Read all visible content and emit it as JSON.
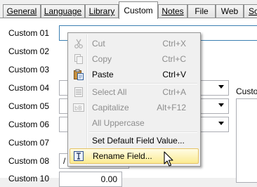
{
  "tabs": [
    {
      "label": "General",
      "active": false
    },
    {
      "label": "Language",
      "active": false
    },
    {
      "label": "Library",
      "active": false
    },
    {
      "label": "Custom",
      "active": true
    },
    {
      "label": "Notes",
      "active": false
    },
    {
      "label": "File",
      "active": false
    },
    {
      "label": "Web",
      "active": false
    },
    {
      "label": "Sc",
      "active": false
    }
  ],
  "fields": [
    {
      "label": "Custom 01"
    },
    {
      "label": "Custom 02"
    },
    {
      "label": "Custom 03"
    },
    {
      "label": "Custom 04"
    },
    {
      "label": "Custom 05"
    },
    {
      "label": "Custom 06"
    },
    {
      "label": "Custom 07"
    },
    {
      "label": "Custom 08",
      "value": "/"
    },
    {
      "label": "Custom 10",
      "value": "0.00"
    }
  ],
  "right_label": "Custo",
  "context_menu": {
    "items": [
      {
        "label": "Cut",
        "shortcut": "Ctrl+X",
        "icon": "scissors-icon",
        "enabled": false
      },
      {
        "label": "Copy",
        "shortcut": "Ctrl+C",
        "icon": "copy-icon",
        "enabled": false
      },
      {
        "label": "Paste",
        "shortcut": "Ctrl+V",
        "icon": "paste-icon",
        "enabled": true
      },
      {
        "label": "Select All",
        "shortcut": "Ctrl+A",
        "icon": "select-all-icon",
        "enabled": false
      },
      {
        "label": "Capitalize",
        "shortcut": "Alt+F12",
        "icon": "capitalize-icon",
        "enabled": false
      },
      {
        "label": "All Uppercase",
        "shortcut": "",
        "icon": "",
        "enabled": false
      },
      {
        "label": "Set Default Field Value...",
        "shortcut": "",
        "icon": "",
        "enabled": true
      },
      {
        "label": "Rename Field...",
        "shortcut": "",
        "icon": "rename-field-icon",
        "enabled": true,
        "highlighted": true
      }
    ]
  }
}
